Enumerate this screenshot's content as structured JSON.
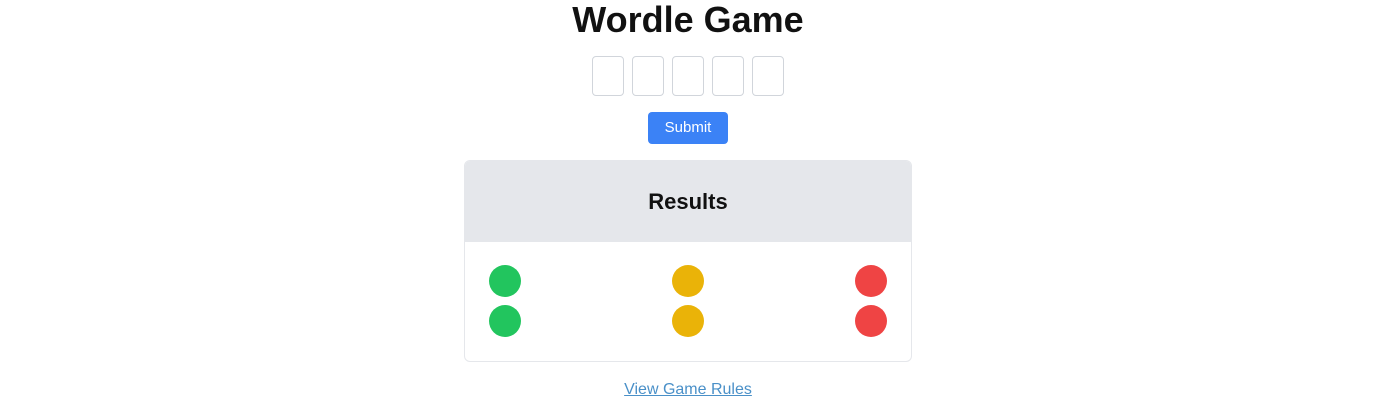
{
  "header": {
    "title": "Wordle Game"
  },
  "guess": {
    "letters": [
      "",
      "",
      "",
      "",
      ""
    ]
  },
  "submit": {
    "label": "Submit"
  },
  "results": {
    "title": "Results",
    "colors": {
      "correct": "#22c55e",
      "present": "#eab308",
      "absent": "#ef4444"
    },
    "rows": [
      [
        "correct",
        "present",
        "absent"
      ],
      [
        "correct",
        "present",
        "absent"
      ]
    ]
  },
  "footer": {
    "rules_link": "View Game Rules"
  },
  "theme": {
    "accent": "#3b82f6",
    "link": "#4a90c8"
  }
}
